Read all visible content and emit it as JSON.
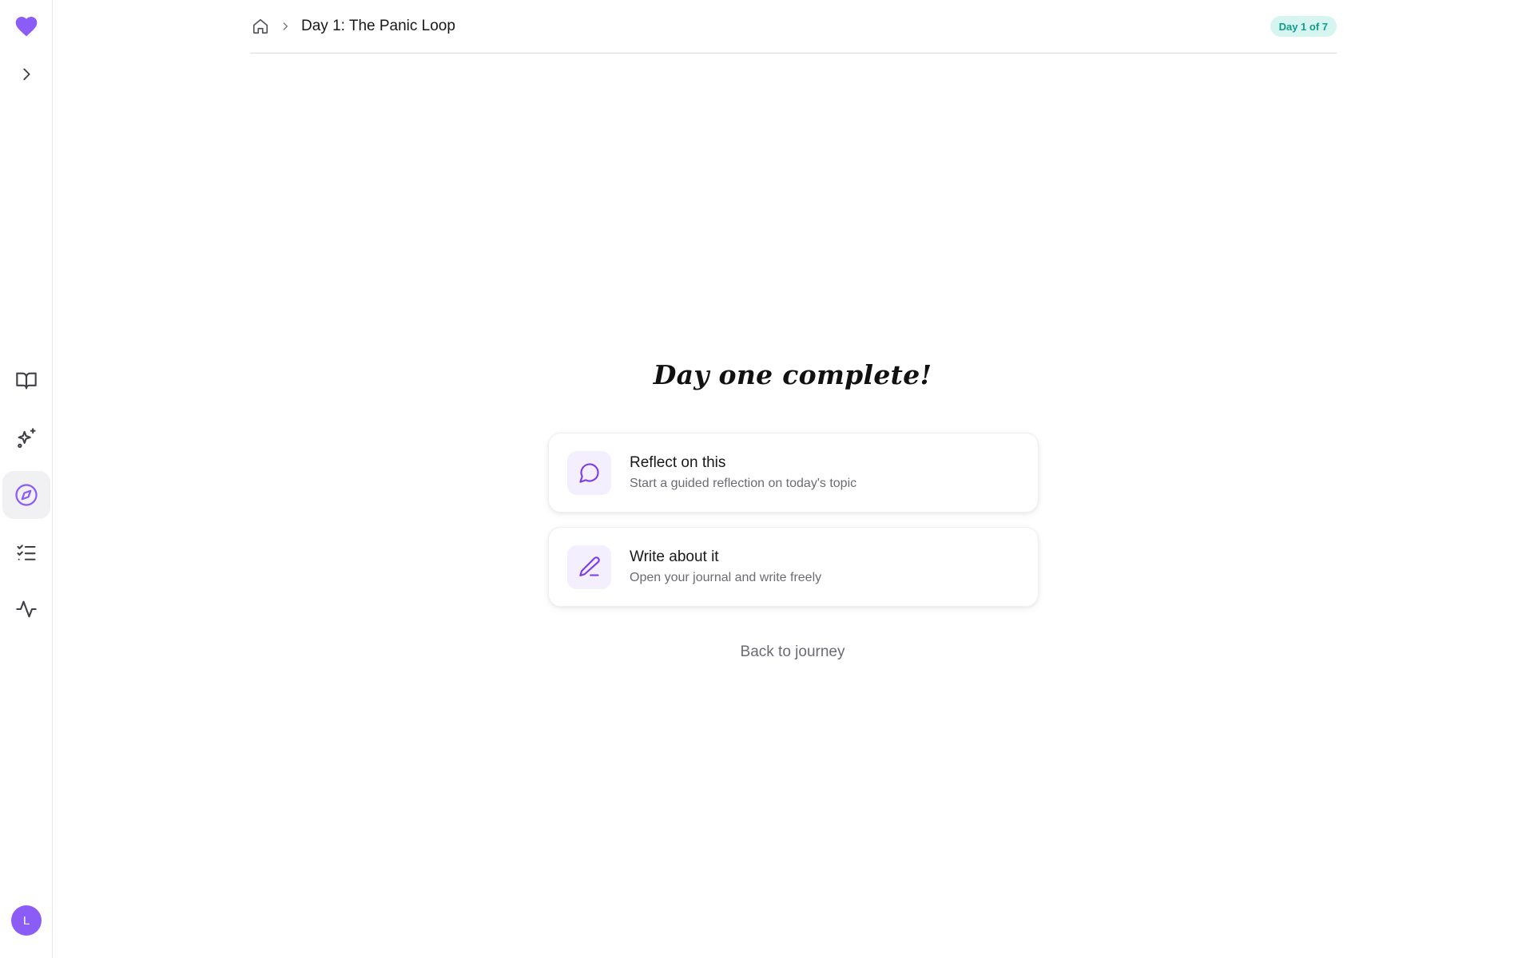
{
  "colors": {
    "accent": "#8b5cf6",
    "accent_dark": "#7c3aed",
    "accent_soft": "#f3effe",
    "badge_bg": "#d6f5f0",
    "badge_text": "#0f9e8a"
  },
  "sidebar": {
    "logo_icon": "heart-icon",
    "expand_icon": "chevron-right-icon",
    "items": [
      {
        "icon": "book-open-icon",
        "active": false
      },
      {
        "icon": "sparkles-icon",
        "active": false
      },
      {
        "icon": "compass-icon",
        "active": true
      },
      {
        "icon": "list-checks-icon",
        "active": false
      },
      {
        "icon": "activity-icon",
        "active": false
      }
    ],
    "avatar_initial": "L"
  },
  "header": {
    "home_icon": "home-icon",
    "separator_icon": "chevron-right-icon",
    "title": "Day 1: The Panic Loop",
    "badge": "Day 1 of 7"
  },
  "main": {
    "title": "Day one complete!",
    "cards": [
      {
        "icon": "message-circle-icon",
        "title": "Reflect on this",
        "subtitle": "Start a guided reflection on today's topic"
      },
      {
        "icon": "pen-icon",
        "title": "Write about it",
        "subtitle": "Open your journal and write freely"
      }
    ],
    "back_link": "Back to journey"
  }
}
